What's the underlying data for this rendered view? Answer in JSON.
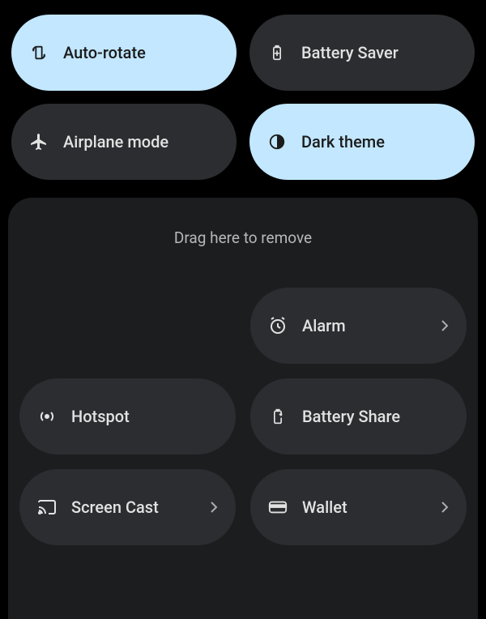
{
  "active_tiles": [
    {
      "id": "auto-rotate",
      "label": "Auto-rotate",
      "icon": "auto-rotate-icon",
      "state": "on",
      "has_chevron": false
    },
    {
      "id": "battery-saver",
      "label": "Battery Saver",
      "icon": "battery-saver-icon",
      "state": "off",
      "has_chevron": false
    },
    {
      "id": "airplane",
      "label": "Airplane mode",
      "icon": "airplane-icon",
      "state": "off",
      "has_chevron": false
    },
    {
      "id": "dark-theme",
      "label": "Dark theme",
      "icon": "dark-theme-icon",
      "state": "on",
      "has_chevron": false
    }
  ],
  "drop_zone": {
    "hint": "Drag here to remove",
    "tiles": [
      {
        "id": "empty",
        "label": "",
        "icon": "",
        "empty": true,
        "has_chevron": false
      },
      {
        "id": "alarm",
        "label": "Alarm",
        "icon": "alarm-icon",
        "empty": false,
        "has_chevron": true
      },
      {
        "id": "hotspot",
        "label": "Hotspot",
        "icon": "hotspot-icon",
        "empty": false,
        "has_chevron": false
      },
      {
        "id": "battery-share",
        "label": "Battery Share",
        "icon": "battery-share-icon",
        "empty": false,
        "has_chevron": false
      },
      {
        "id": "screen-cast",
        "label": "Screen Cast",
        "icon": "screen-cast-icon",
        "empty": false,
        "has_chevron": true
      },
      {
        "id": "wallet",
        "label": "Wallet",
        "icon": "wallet-icon",
        "empty": false,
        "has_chevron": true
      }
    ]
  }
}
